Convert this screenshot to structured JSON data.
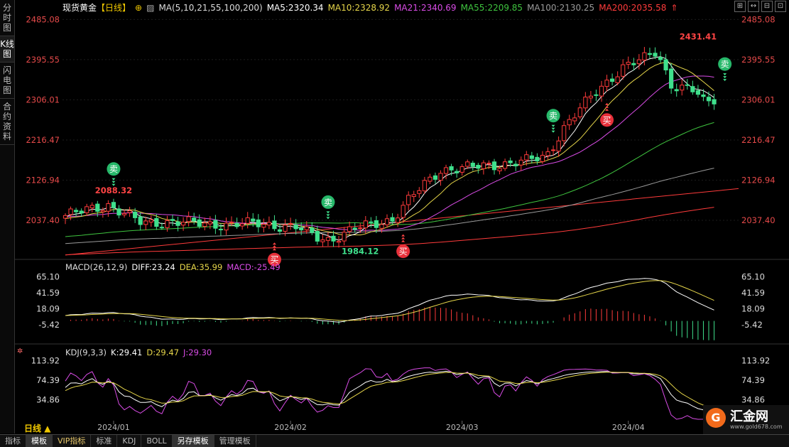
{
  "sidebar": {
    "tabs": [
      {
        "label": "分时图",
        "active": false
      },
      {
        "label": "K线图",
        "active": true
      },
      {
        "label": "闪电图",
        "active": false
      },
      {
        "label": "合约资料",
        "active": false
      }
    ]
  },
  "header": {
    "title": "现货黄金",
    "period_tag": "【日线】",
    "ma_label": "MA(5,10,21,55,100,200)",
    "ma5": "MA5:2320.34",
    "ma10": "MA10:2328.92",
    "ma21": "MA21:2340.69",
    "ma55": "MA55:2209.85",
    "ma100": "MA100:2130.25",
    "ma200": "MA200:2035.58",
    "icons": [
      "⊞",
      "↔",
      "⊟",
      "⊡"
    ]
  },
  "macd": {
    "title": "MACD(26,12,9)",
    "diff": "DIFF:23.24",
    "dea": "DEA:35.99",
    "macd": "MACD:-25.49"
  },
  "kdj": {
    "title": "KDJ(9,3,3)",
    "k": "K:29.41",
    "d": "D:29.47",
    "j": "J:29.30"
  },
  "colors": {
    "up": "#ff3b3b",
    "down": "#3fe08c",
    "ma5": "#ffffff",
    "ma10": "#e6d64a",
    "ma21": "#d94ce6",
    "ma55": "#3fc43f",
    "ma100": "#9a9a9a",
    "ma200": "#ff3b3b"
  },
  "period_label": "日线",
  "bottom_tabs": [
    {
      "label": "指标"
    },
    {
      "label": "模板",
      "active": true
    },
    {
      "label": "VIP指标",
      "vip": true
    },
    {
      "label": "标准"
    },
    {
      "label": "KDJ"
    },
    {
      "label": "BOLL"
    },
    {
      "label": "另存模板",
      "active": true
    },
    {
      "label": "管理模板"
    }
  ],
  "logo": {
    "mark": "G",
    "name": "汇金网",
    "url": "www.gold678.com"
  },
  "chart_data": {
    "type": "candlestick",
    "price_axis_ticks": [
      "2485.08",
      "2395.55",
      "2306.01",
      "2216.47",
      "2126.94",
      "2037.40"
    ],
    "price_axis_values": [
      2485.08,
      2395.55,
      2306.01,
      2216.47,
      2126.94,
      2037.4
    ],
    "price_range": [
      1955,
      2500
    ],
    "macd_axis_ticks": [
      "65.10",
      "41.59",
      "18.09",
      "-5.42"
    ],
    "macd_axis_values": [
      65.1,
      41.59,
      18.09,
      -5.42
    ],
    "macd_range": [
      -35,
      75
    ],
    "kdj_axis_ticks": [
      "113.92",
      "74.39",
      "34.86"
    ],
    "kdj_axis_values": [
      113.92,
      74.39,
      34.86
    ],
    "kdj_range": [
      -5,
      125
    ],
    "x_labels": [
      {
        "label": "2024/01",
        "index": 9
      },
      {
        "label": "2024/02",
        "index": 42
      },
      {
        "label": "2024/03",
        "index": 74
      },
      {
        "label": "2024/04",
        "index": 105
      }
    ],
    "annotations": [
      {
        "text": "2088.32",
        "index": 9,
        "value": 2088.32,
        "kind": "high"
      },
      {
        "text": "1984.12",
        "index": 55,
        "value": 1984.12,
        "kind": "low"
      },
      {
        "text": "2431.41",
        "index": 118,
        "value": 2431.41,
        "kind": "high"
      }
    ],
    "signals": [
      {
        "label": "卖",
        "type": "sell",
        "index": 9
      },
      {
        "label": "卖",
        "type": "sell",
        "index": 49
      },
      {
        "label": "买",
        "type": "buy",
        "index": 39
      },
      {
        "label": "买",
        "type": "buy",
        "index": 63
      },
      {
        "label": "卖",
        "type": "sell",
        "index": 91
      },
      {
        "label": "买",
        "type": "buy",
        "index": 101
      },
      {
        "label": "卖",
        "type": "sell",
        "index": 123
      }
    ]
  }
}
